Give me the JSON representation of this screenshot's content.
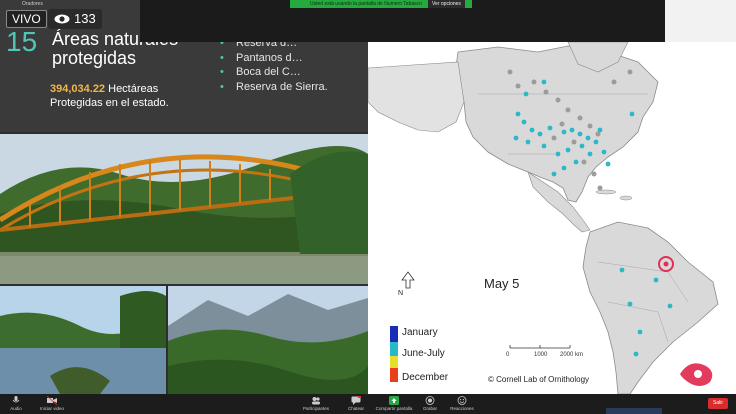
{
  "slide": {
    "number": "15",
    "title": "Áreas naturales protegidas",
    "hectares_value": "394,034.22",
    "hectares_unit": "Hectáreas",
    "hectares_line2": "Protegidas en el estado.",
    "bullets": [
      "Reserva d…",
      "Pantanos d…",
      "Boca del C…",
      "Reserva de Sierra."
    ]
  },
  "live": {
    "badge": "VIVO",
    "viewers": "133"
  },
  "share_bar": {
    "text": "Usted está usando la pantalla de Numero Tabasco",
    "view_options": "Ver opciones"
  },
  "presenter": {
    "name": "Oradores"
  },
  "map": {
    "date": "May 5",
    "north": "N",
    "legend": [
      "January",
      "June-July",
      "December"
    ],
    "legend_colors": [
      "#1a2bb8",
      "#27b9c7",
      "#e8dd2a",
      "#e8401c"
    ],
    "scale": [
      "0",
      "1000",
      "2000 km"
    ],
    "credit": "© Cornell Lab of Ornithology"
  },
  "toolbar": {
    "items": [
      {
        "label": "Audio",
        "icon": "mic-icon"
      },
      {
        "label": "Iniciar video",
        "icon": "video-icon"
      },
      {
        "label": "Participantes",
        "icon": "participants-icon"
      },
      {
        "label": "Chatear",
        "icon": "chat-icon"
      },
      {
        "label": "Compartir pantalla",
        "icon": "share-screen-icon"
      },
      {
        "label": "Grabar",
        "icon": "record-icon"
      },
      {
        "label": "Reacciones",
        "icon": "reactions-icon"
      }
    ],
    "end": "Salir"
  }
}
